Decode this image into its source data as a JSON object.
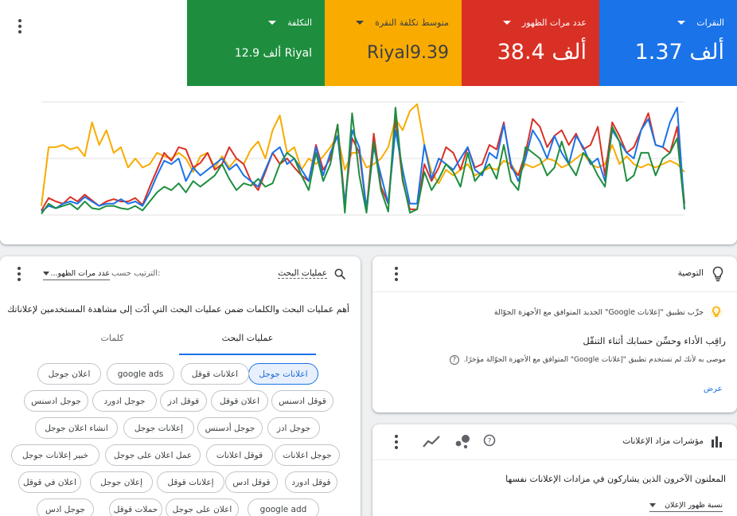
{
  "metrics": {
    "clicks": {
      "label": "النقرات",
      "value": "1.37 ألف",
      "color": "#1a73e8"
    },
    "impressions": {
      "label": "عدد مرات الظهور",
      "value": "38.4 ألف",
      "color": "#d93025"
    },
    "avg_cpc": {
      "label": "متوسط تكلفة النقرة",
      "value": "Riyal9.39",
      "color": "#f9ab00"
    },
    "cost": {
      "label": "التكلفة",
      "value": "12.9 ألف Riyal",
      "color": "#1e8e3e"
    }
  },
  "chart_data": {
    "type": "line",
    "x": [
      1,
      2,
      3,
      4,
      5,
      6,
      7,
      8,
      9,
      10,
      11,
      12,
      13,
      14,
      15,
      16,
      17,
      18,
      19,
      20,
      21,
      22,
      23,
      24,
      25,
      26,
      27,
      28,
      29,
      30,
      31,
      32,
      33,
      34,
      35,
      36,
      37,
      38,
      39,
      40,
      41,
      42,
      43,
      44,
      45,
      46,
      47,
      48,
      49,
      50,
      51,
      52,
      53,
      54,
      55,
      56,
      57,
      58,
      59,
      60,
      61,
      62,
      63,
      64,
      65,
      66,
      67,
      68,
      69,
      70,
      71,
      72,
      73,
      74,
      75,
      76,
      77,
      78,
      79,
      80,
      81,
      82,
      83,
      84,
      85,
      86,
      87,
      88,
      89,
      90
    ],
    "series": [
      {
        "color": "#1a73e8",
        "values": [
          0.03,
          0.08,
          0.06,
          0.1,
          0.12,
          0.1,
          0.16,
          0.12,
          0.08,
          0.1,
          0.1,
          0.14,
          0.1,
          0.12,
          0.08,
          0.2,
          0.35,
          0.48,
          0.45,
          0.5,
          0.3,
          0.42,
          0.35,
          0.4,
          0.45,
          0.5,
          0.4,
          0.45,
          0.35,
          0.3,
          0.25,
          0.4,
          0.55,
          0.6,
          0.45,
          0.5,
          0.4,
          0.3,
          0.6,
          0.35,
          0.55,
          0.7,
          0.1,
          0.75,
          0.6,
          0.05,
          0.6,
          0.35,
          0.1,
          0.75,
          0.4,
          0.1,
          0.1,
          0.62,
          0.32,
          0.5,
          0.45,
          0.4,
          0.5,
          0.6,
          0.4,
          0.35,
          0.55,
          0.5,
          0.8,
          0.45,
          0.3,
          0.5,
          0.75,
          0.65,
          0.5,
          0.7,
          0.55,
          0.45,
          0.7,
          0.6,
          0.45,
          0.5,
          0.3,
          0.75,
          0.65,
          0.55,
          0.5,
          0.75,
          0.85,
          0.62,
          0.6,
          0.82,
          0.95,
          0.05
        ]
      },
      {
        "color": "#d93025",
        "values": [
          0.04,
          0.15,
          0.12,
          0.1,
          0.16,
          0.12,
          0.18,
          0.13,
          0.08,
          0.12,
          0.14,
          0.12,
          0.12,
          0.15,
          0.09,
          0.25,
          0.4,
          0.55,
          0.48,
          0.6,
          0.58,
          0.42,
          0.46,
          0.55,
          0.4,
          0.45,
          0.6,
          0.5,
          0.45,
          0.3,
          0.22,
          0.38,
          0.55,
          0.45,
          0.5,
          0.42,
          0.35,
          0.3,
          0.62,
          0.4,
          0.5,
          0.8,
          0.1,
          0.68,
          0.55,
          0.05,
          0.72,
          0.25,
          0.1,
          0.85,
          0.3,
          0.05,
          0.05,
          0.45,
          0.3,
          0.42,
          0.6,
          0.55,
          0.4,
          0.6,
          0.42,
          0.45,
          0.62,
          0.58,
          0.82,
          0.42,
          0.35,
          0.55,
          0.85,
          0.78,
          0.6,
          0.7,
          0.75,
          0.62,
          0.72,
          0.58,
          0.62,
          0.78,
          0.35,
          0.82,
          0.7,
          0.55,
          0.6,
          0.75,
          0.9,
          0.62,
          0.6,
          0.55,
          0.78,
          0.1
        ]
      },
      {
        "color": "#f9ab00",
        "values": [
          0.08,
          0.6,
          0.6,
          0.62,
          0.58,
          0.6,
          0.52,
          0.82,
          0.62,
          0.75,
          0.55,
          0.6,
          0.42,
          0.5,
          0.42,
          0.45,
          0.55,
          0.52,
          0.5,
          0.55,
          0.5,
          0.38,
          0.52,
          0.55,
          0.42,
          0.52,
          0.42,
          0.5,
          0.45,
          0.58,
          0.65,
          0.5,
          0.75,
          0.88,
          0.55,
          0.6,
          0.4,
          0.5,
          0.45,
          0.52,
          0.6,
          0.7,
          0.4,
          0.55,
          0.55,
          0.42,
          0.45,
          0.5,
          0.6,
          0.85,
          0.75,
          0.92,
          0.98,
          0.62,
          0.38,
          0.28,
          0.4,
          0.35,
          0.4,
          0.45,
          0.35,
          0.38,
          0.42,
          0.4,
          0.48,
          0.45,
          0.35,
          0.45,
          0.42,
          0.45,
          0.5,
          0.48,
          0.42,
          0.45,
          0.5,
          0.55,
          0.45,
          0.42,
          0.45,
          0.62,
          0.45,
          0.52,
          0.45,
          0.42,
          0.45,
          0.42,
          0.45,
          0.48,
          0.45,
          0.38
        ]
      },
      {
        "color": "#1e8e3e",
        "values": [
          0.01,
          0.1,
          0.06,
          0.08,
          0.1,
          0.05,
          0.12,
          0.06,
          0.05,
          0.08,
          0.08,
          0.06,
          0.05,
          0.08,
          0.04,
          0.12,
          0.2,
          0.25,
          0.22,
          0.28,
          0.2,
          0.3,
          0.25,
          0.3,
          0.35,
          0.45,
          0.32,
          0.22,
          0.28,
          0.26,
          0.32,
          0.25,
          0.28,
          0.45,
          0.55,
          0.5,
          0.35,
          0.22,
          0.55,
          0.3,
          0.45,
          0.8,
          0.02,
          0.9,
          0.35,
          0.02,
          0.65,
          0.22,
          0.03,
          0.95,
          0.32,
          0.02,
          0.05,
          0.38,
          0.22,
          0.32,
          0.45,
          0.38,
          0.25,
          0.55,
          0.3,
          0.38,
          0.45,
          0.32,
          0.62,
          0.3,
          0.22,
          0.6,
          0.55,
          0.5,
          0.35,
          0.42,
          0.65,
          0.45,
          0.35,
          0.55,
          0.48,
          0.35,
          0.25,
          0.78,
          0.65,
          0.3,
          0.35,
          0.55,
          0.55,
          0.35,
          0.5,
          0.55,
          0.68,
          0.05
        ]
      }
    ],
    "ylim": [
      0,
      1
    ],
    "grid": true
  },
  "search_terms": {
    "header_label": "عمليات البحث",
    "sort_label": "الترتيب حسب:",
    "sort_value": "عدد مرات الظهو...",
    "description": "أهم عمليات البحث والكلمات ضمن عمليات البحث التي أدّت إلى مشاهدة المستخدمين لإعلاناتك",
    "tabs": [
      "عمليات البحث",
      "كلمات"
    ],
    "chips": [
      "اعلانات جوجل",
      "اعلانات قوقل",
      "google ads",
      "اعلان جوجل",
      "قوقل ادسنس",
      "اعلان قوقل",
      "قوقل ادز",
      "جوجل ادورد",
      "جوجل ادسنس",
      "جوجل ادز",
      "جوجل أدسنس",
      "إعلانات جوجل",
      "انشاء اعلان جوجل",
      "جوجل اعلانات",
      "قوقل اعلانات",
      "عمل اعلان على جوجل",
      "خبير إعلانات جوجل",
      "قوقل ادورد",
      "قوقل ادس",
      "إعلانات قوقل",
      "إعلان جوجل",
      "اعلان في قوقل",
      "google add",
      "اعلان على جوجل",
      "حملات قوقل",
      "جوجل ادس"
    ]
  },
  "recommendation": {
    "title": "التوصية",
    "try_text": "جرِّب تطبيق \"إعلانات Google\" الجديد المتوافق مع الأجهزة الجوّالة",
    "headline": "راقِب الأداء وحسِّن حسابك أثناء التنقّل",
    "sub": "موصى به لأنك لم تستخدم تطبيق \"إعلانات Google\" المتوافق مع الأجهزة الجوّالة مؤخرًا.",
    "link": "عرض"
  },
  "auction": {
    "title": "مؤشرات مزاد الإعلانات",
    "description": "المعلنون الآخرون الذين يشاركون في مزادات الإعلانات نفسها",
    "select_value": "نسبة ظهور الإعلان"
  }
}
